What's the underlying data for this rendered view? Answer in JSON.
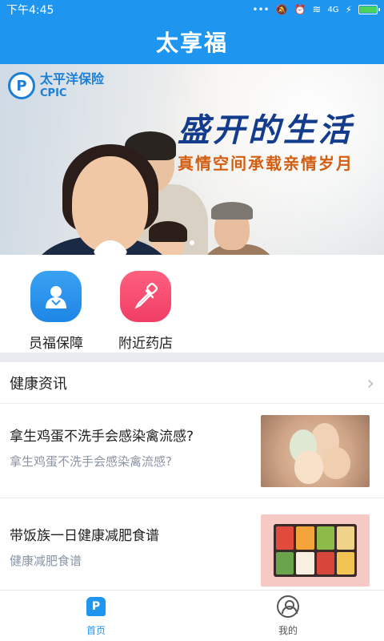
{
  "status_bar": {
    "time": "下午4:45",
    "network": "4G"
  },
  "app": {
    "title": "太享福"
  },
  "banner": {
    "brand_cn": "太平洋保险",
    "brand_en": "CPIC",
    "headline": "盛开的生活",
    "subline": "真情空间承载亲情岁月"
  },
  "quick_entries": [
    {
      "label": "员福保障",
      "icon": "person-icon",
      "color": "#2b93ee"
    },
    {
      "label": "附近药店",
      "icon": "dropper-icon",
      "color": "#f44a6e"
    }
  ],
  "news": {
    "section_title": "健康资讯",
    "articles": [
      {
        "title": "拿生鸡蛋不洗手会感染禽流感?",
        "subtitle": "拿生鸡蛋不洗手会感染禽流感?"
      },
      {
        "title": "带饭族一日健康减肥食谱",
        "subtitle": "健康减肥食谱"
      }
    ]
  },
  "bottom_nav": {
    "home_label": "首页",
    "me_label": "我的"
  },
  "colors": {
    "primary": "#1e96f0",
    "entry_blue": "#2b93ee",
    "entry_red": "#f44a6e"
  }
}
